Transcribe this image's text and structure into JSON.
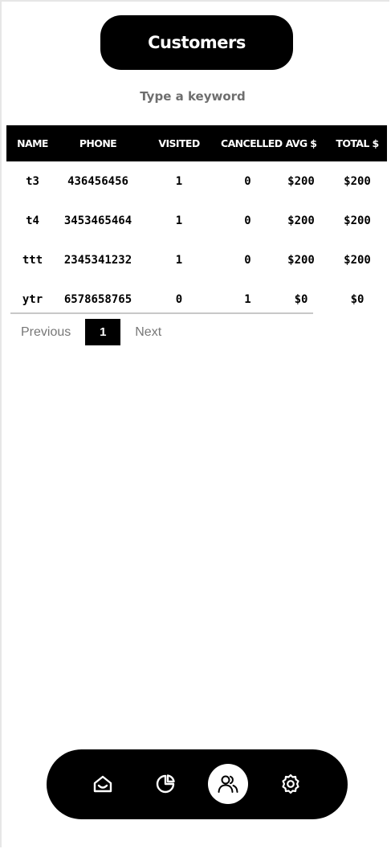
{
  "header": {
    "title": "Customers"
  },
  "search": {
    "placeholder": "Type a keyword",
    "value": ""
  },
  "table": {
    "columns": [
      "NAME",
      "PHONE",
      "VISITED",
      "CANCELLED",
      "AVG $",
      "TOTAL $"
    ],
    "rows": [
      [
        "t3",
        "436456456",
        "1",
        "0",
        "$200",
        "$200"
      ],
      [
        "t4",
        "3453465464",
        "1",
        "0",
        "$200",
        "$200"
      ],
      [
        "ttt",
        "2345341232",
        "1",
        "0",
        "$200",
        "$200"
      ],
      [
        "ytr",
        "6578658765",
        "0",
        "1",
        "$0",
        "$0"
      ]
    ]
  },
  "pagination": {
    "previous": "Previous",
    "current": "1",
    "next": "Next"
  },
  "bottom_nav": {
    "items": [
      {
        "icon": "home-icon",
        "active": false
      },
      {
        "icon": "pie-chart-icon",
        "active": false
      },
      {
        "icon": "users-icon",
        "active": true
      },
      {
        "icon": "settings-icon",
        "active": false
      }
    ]
  }
}
